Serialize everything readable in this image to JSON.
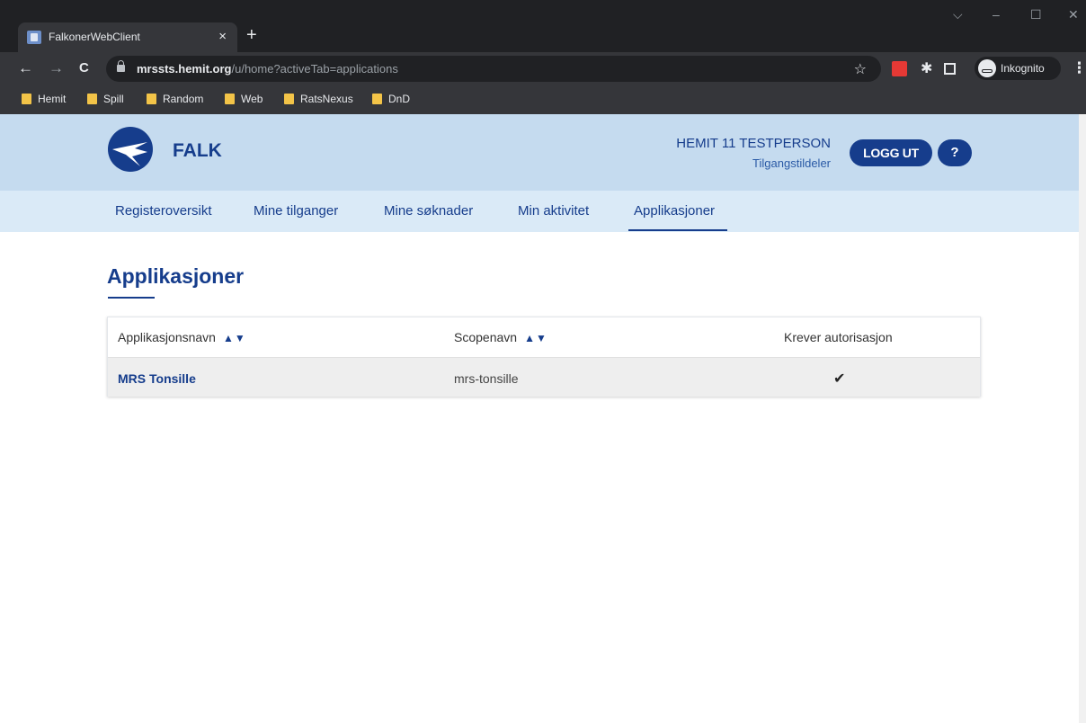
{
  "browser": {
    "tab_title": "FalkonerWebClient",
    "tab_close": "×",
    "new_tab": "+",
    "window_controls": {
      "minimize": "–",
      "maximize": "☐",
      "close": "✕",
      "tabsearch": "⌵"
    },
    "nav": {
      "back": "←",
      "forward": "→",
      "reload": "C"
    },
    "url_host": "mrssts.hemit.org",
    "url_path": "/u/home?activeTab=applications",
    "incognito_label": "Inkognito",
    "bookmarks": [
      "Hemit",
      "Spill",
      "Random",
      "Web",
      "RatsNexus",
      "DnD"
    ],
    "icons": [
      "star-icon",
      "extension-icon",
      "puzzle-icon",
      "side-panel-icon",
      "incognito-icon",
      "menu-icon"
    ]
  },
  "header": {
    "brand": "FALK",
    "user_name": "HEMIT 11 TESTPERSON",
    "user_role": "Tilgangstildeler",
    "logout_label": "LOGG UT",
    "help_label": "?"
  },
  "nav": {
    "items": [
      "Registeroversikt",
      "Mine tilganger",
      "Mine søknader",
      "Min aktivitet",
      "Applikasjoner"
    ],
    "active": "Applikasjoner"
  },
  "main": {
    "title": "Applikasjoner",
    "table": {
      "headers": [
        "Applikasjonsnavn",
        "Scopenavn",
        "Krever autorisasjon"
      ],
      "sort_arrows": "▲▼",
      "rows": [
        {
          "name": "MRS Tonsille",
          "scope": "mrs-tonsille",
          "requires_auth": "✔"
        }
      ]
    }
  },
  "colors": {
    "primary": "#163d8c",
    "header_bg": "#c5dbef",
    "nav_bg": "#daeaf7"
  }
}
